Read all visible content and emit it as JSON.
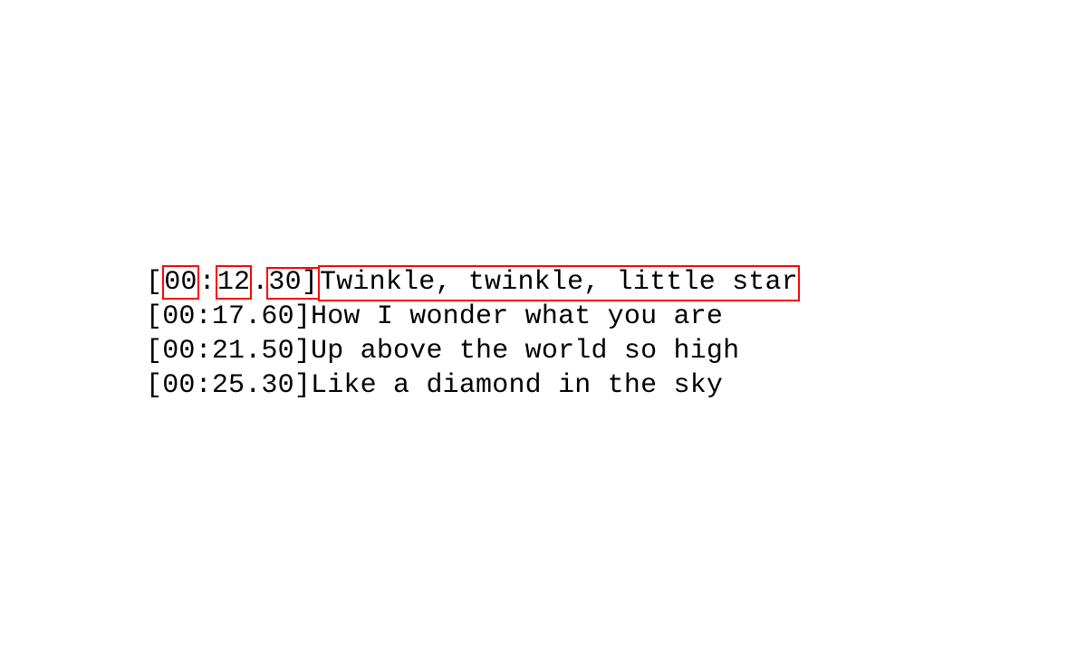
{
  "lyrics": [
    {
      "minutes": "00",
      "seconds": "12",
      "hundredths": "30",
      "text": "Twinkle, twinkle, little star",
      "highlighted": true
    },
    {
      "minutes": "00",
      "seconds": "17",
      "hundredths": "60",
      "text": "How I wonder what you are",
      "highlighted": false
    },
    {
      "minutes": "00",
      "seconds": "21",
      "hundredths": "50",
      "text": "Up above the world so high",
      "highlighted": false
    },
    {
      "minutes": "00",
      "seconds": "25",
      "hundredths": "30",
      "text": "Like a diamond in the sky",
      "highlighted": false
    }
  ],
  "brackets": {
    "open": "[",
    "close": "]"
  },
  "separators": {
    "colon": ":",
    "dot": "."
  }
}
